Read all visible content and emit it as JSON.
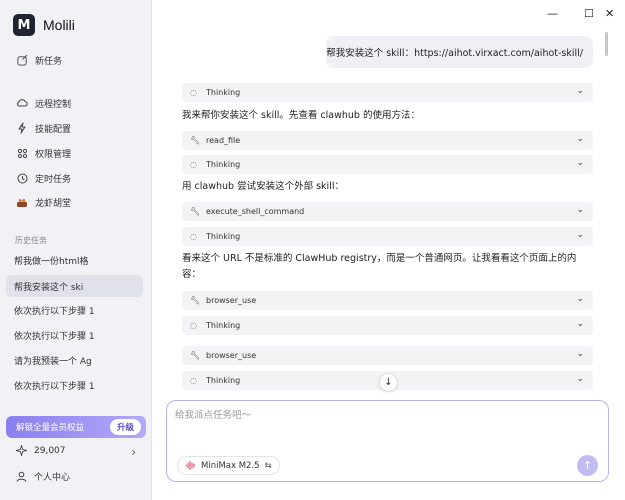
{
  "app": {
    "name": "Molili",
    "logo_letter": "M"
  },
  "sidebar": {
    "new_task": "新任务",
    "nav": [
      {
        "label": "远程控制",
        "icon": "cloud-icon"
      },
      {
        "label": "技能配置",
        "icon": "lightning-icon"
      },
      {
        "label": "权限管理",
        "icon": "grid-icon"
      },
      {
        "label": "定时任务",
        "icon": "clock-icon"
      },
      {
        "label": "龙虾胡堂",
        "icon": "lobster-icon"
      }
    ],
    "history_title": "历史任务",
    "history": [
      "帮我做一份html格",
      "帮我安装这个 ski",
      "依次执行以下步骤 1",
      "依次执行以下步骤 1",
      "请为我预装一个 Ag",
      "依次执行以下步骤 1"
    ],
    "upgrade_label": "解锁全量会员权益",
    "upgrade_button": "升级",
    "credits": "29,007",
    "user_center": "个人中心"
  },
  "window_controls": {
    "minimize": "—",
    "maximize": "☐",
    "close": "✕"
  },
  "chat": {
    "user_message": "帮我安装这个 skill：https://aihot.virxact.com/aihot-skill/",
    "tools": [
      "Thinking",
      "read_file",
      "Thinking",
      "execute_shell_command",
      "Thinking",
      "browser_use",
      "Thinking",
      "browser_use",
      "Thinking"
    ],
    "paragraphs": [
      "我来帮你安装这个 skill。先查看 clawhub 的使用方法：",
      "用 clawhub 尝试安装这个外部 skill：",
      "看来这个 URL 不是标准的 ClawHub registry，而是一个普通网页。让我看看这个页面上的内容："
    ]
  },
  "composer": {
    "placeholder": "给我派点任务吧～",
    "model": "MiniMax M2.5",
    "model_switch": "⇆"
  },
  "colors": {
    "accent": "#8a7ff0",
    "sidebar_bg": "#f1f1f6"
  }
}
